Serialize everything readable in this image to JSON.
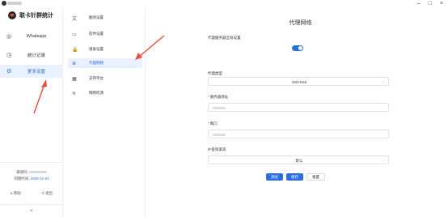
{
  "app": {
    "title": "联卡针群统计",
    "window_controls": [
      "–",
      "□",
      "×"
    ]
  },
  "sidebar": {
    "items": [
      {
        "icon": "whatsapp-icon",
        "glyph": "◎",
        "label": "Whatsapp"
      },
      {
        "icon": "stats-icon",
        "glyph": "◷",
        "label": "统计记录"
      },
      {
        "icon": "settings-icon",
        "glyph": "⚙",
        "label": "更多设置"
      }
    ],
    "account": {
      "label": "邀请码:",
      "expire_label": "到期时间:",
      "expire_date": "2025-11-04"
    },
    "help_label": "帮助",
    "logout_label": "退出",
    "collapse_glyph": "<"
  },
  "submenu": {
    "items": [
      {
        "icon": "translate-icon",
        "glyph": "文",
        "label": "翻译设置"
      },
      {
        "icon": "monitor-icon",
        "glyph": "▭",
        "label": "软件设置"
      },
      {
        "icon": "lock-icon",
        "glyph": "🔒",
        "label": "锁屏设置"
      },
      {
        "icon": "globe-icon",
        "glyph": "⊕",
        "label": "代理网络"
      },
      {
        "icon": "grid-icon",
        "glyph": "▦",
        "label": "支持平台"
      },
      {
        "icon": "wifi-icon",
        "glyph": "≋",
        "label": "网络检测"
      }
    ]
  },
  "main": {
    "title": "代理网络",
    "global_proxy_label": "代理服务器全局设置",
    "global_proxy_on": true,
    "proxy_type_label": "代理类型",
    "proxy_type_value": "SOCKS5",
    "server_label": "服务器地址",
    "port_label": "端口",
    "ip_query_label": "IP查询渠道",
    "ip_query_value": "默认",
    "buttons": {
      "test": "测试",
      "save": "保存",
      "reset": "重置"
    },
    "colors": {
      "accent": "#2d6fe0",
      "required": "#e74c3c",
      "annotation": "#e74c3c"
    }
  }
}
